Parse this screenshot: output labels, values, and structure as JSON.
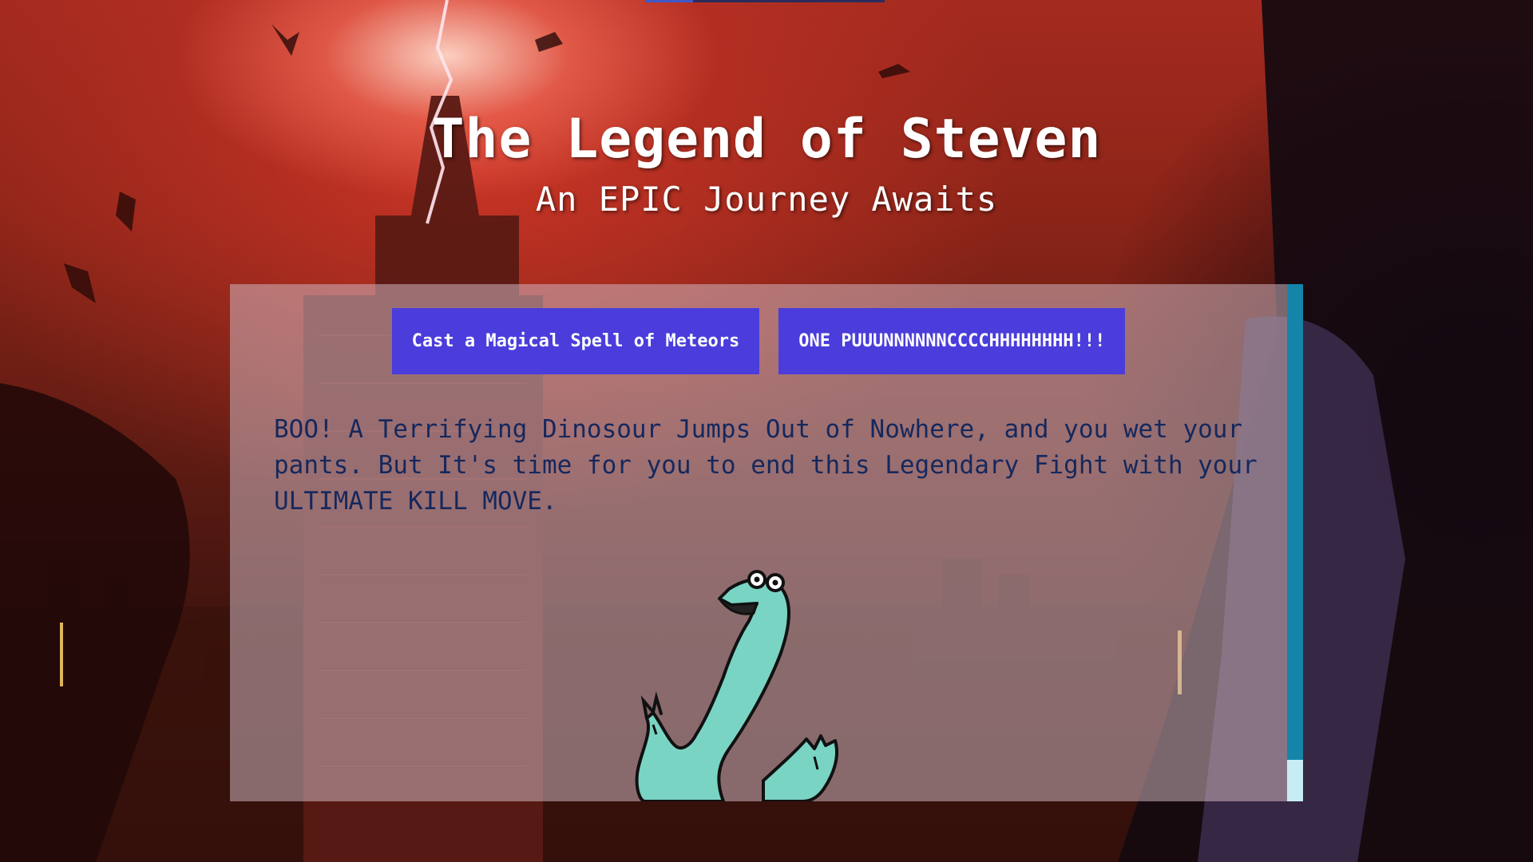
{
  "header": {
    "title": "The Legend of Steven",
    "subtitle": "An EPIC Journey Awaits"
  },
  "actions": {
    "meteor_label": "Cast a Magical Spell of Meteors",
    "punch_label": "ONE PUUUNNNNNNCCCCHHHHHHHH!!!"
  },
  "story": {
    "text": "BOO! A Terrifying Dinosour Jumps Out of Nowhere, and you wet your pants. But It's time for you to end this Legendary Fight with your ULTIMATE KILL MOVE."
  },
  "colors": {
    "button": "#4a3ddb",
    "story_text": "#15285e",
    "scrollbar": "#1485a9",
    "dino": "#79d4c4"
  },
  "icons": {
    "dinosaur": "dinosaur-illustration"
  }
}
